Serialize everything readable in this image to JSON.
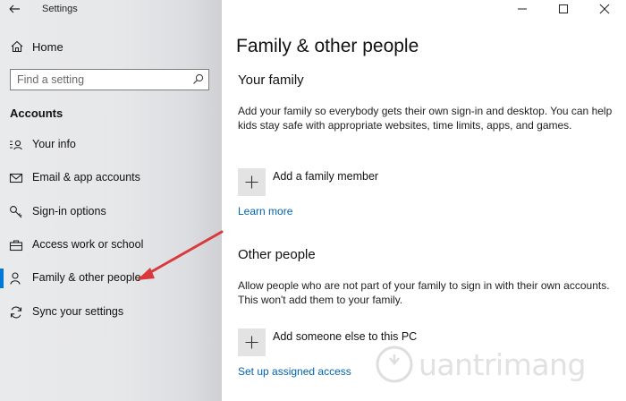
{
  "window": {
    "title": "Settings"
  },
  "sidebar": {
    "home_label": "Home",
    "search_placeholder": "Find a setting",
    "section_title": "Accounts",
    "items": [
      {
        "label": "Your info",
        "icon": "person-lines-icon"
      },
      {
        "label": "Email & app accounts",
        "icon": "mail-icon"
      },
      {
        "label": "Sign-in options",
        "icon": "key-icon"
      },
      {
        "label": "Access work or school",
        "icon": "briefcase-icon"
      },
      {
        "label": "Family & other people",
        "icon": "person-icon",
        "selected": true
      },
      {
        "label": "Sync your settings",
        "icon": "sync-icon"
      }
    ]
  },
  "main": {
    "title": "Family & other people",
    "family": {
      "heading": "Your family",
      "description": "Add your family so everybody gets their own sign-in and desktop. You can help kids stay safe with appropriate websites, time limits, apps, and games.",
      "add_label": "Add a family member",
      "link": "Learn more"
    },
    "other": {
      "heading": "Other people",
      "description": "Allow people who are not part of your family to sign in with their own accounts. This won't add them to your family.",
      "add_label": "Add someone else to this PC",
      "link": "Set up assigned access"
    }
  },
  "watermark": "uantrimang",
  "colors": {
    "accent": "#0078d7",
    "link": "#0063b1",
    "arrow": "#d9393c"
  }
}
